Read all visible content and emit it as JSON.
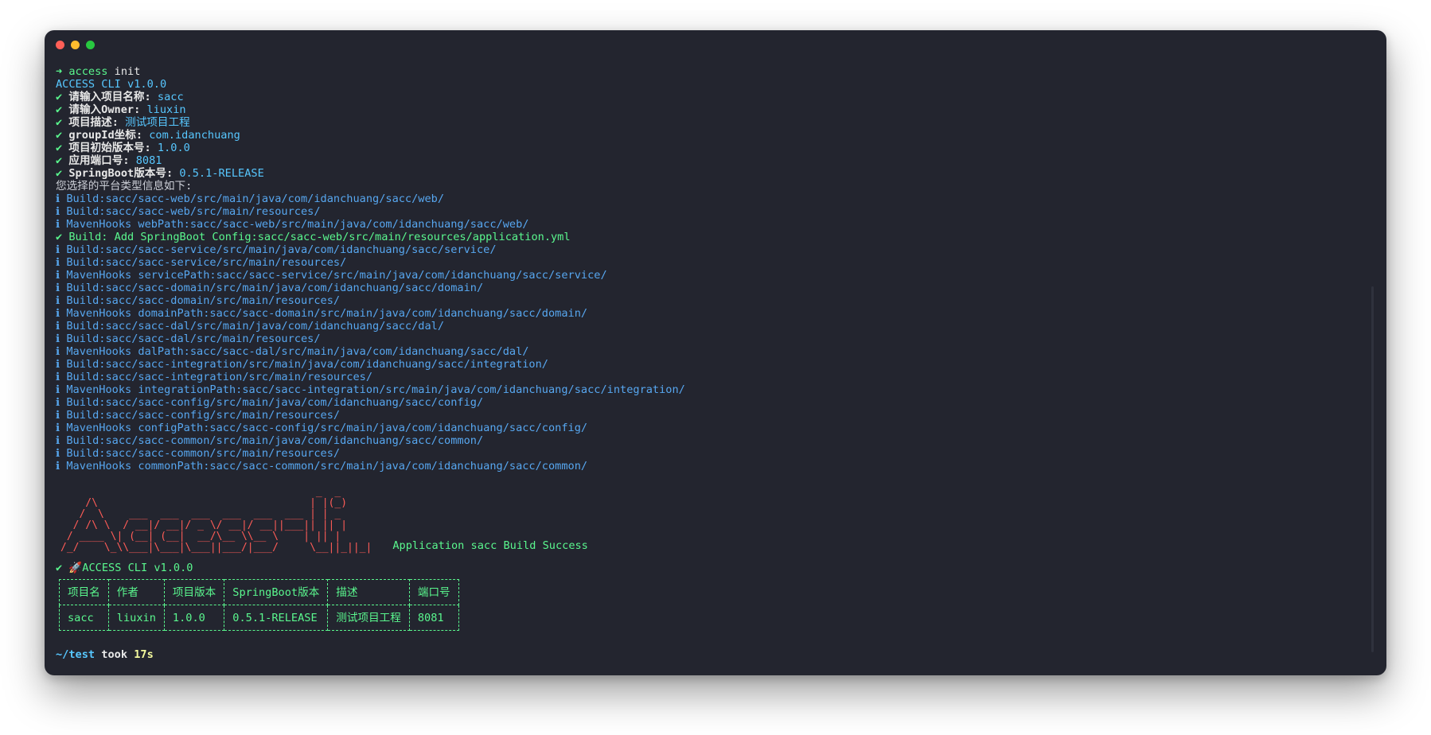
{
  "window": {
    "traffic_lights": [
      "close",
      "minimize",
      "zoom"
    ]
  },
  "terminal": {
    "prompt_arrow": "➜",
    "command": "access",
    "command_arg": " init",
    "version_line": "ACCESS CLI v1.0.0",
    "answers": [
      {
        "mark": "✔",
        "label": "请输入项目名称:",
        "value": "sacc"
      },
      {
        "mark": "✔",
        "label": "请输入Owner:",
        "value": "liuxin"
      },
      {
        "mark": "✔",
        "label": "项目描述:",
        "value": "测试项目工程"
      },
      {
        "mark": "✔",
        "label": "groupId坐标:",
        "value": "com.idanchuang"
      },
      {
        "mark": "✔",
        "label": "项目初始版本号:",
        "value": "1.0.0"
      },
      {
        "mark": "✔",
        "label": "应用端口号:",
        "value": "8081"
      },
      {
        "mark": "✔",
        "label": "SpringBoot版本号:",
        "value": "0.5.1-RELEASE"
      }
    ],
    "platform_line": "您选择的平台类型信息如下:",
    "build_logs": [
      {
        "mark": "ℹ",
        "kind": "info",
        "text": "Build:sacc/sacc-web/src/main/java/com/idanchuang/sacc/web/"
      },
      {
        "mark": "ℹ",
        "kind": "info",
        "text": "Build:sacc/sacc-web/src/main/resources/"
      },
      {
        "mark": "ℹ",
        "kind": "info",
        "text": "MavenHooks webPath:sacc/sacc-web/src/main/java/com/idanchuang/sacc/web/"
      },
      {
        "mark": "✔",
        "kind": "success",
        "text": "Build: Add SpringBoot Config:sacc/sacc-web/src/main/resources/application.yml"
      },
      {
        "mark": "ℹ",
        "kind": "info",
        "text": "Build:sacc/sacc-service/src/main/java/com/idanchuang/sacc/service/"
      },
      {
        "mark": "ℹ",
        "kind": "info",
        "text": "Build:sacc/sacc-service/src/main/resources/"
      },
      {
        "mark": "ℹ",
        "kind": "info",
        "text": "MavenHooks servicePath:sacc/sacc-service/src/main/java/com/idanchuang/sacc/service/"
      },
      {
        "mark": "ℹ",
        "kind": "info",
        "text": "Build:sacc/sacc-domain/src/main/java/com/idanchuang/sacc/domain/"
      },
      {
        "mark": "ℹ",
        "kind": "info",
        "text": "Build:sacc/sacc-domain/src/main/resources/"
      },
      {
        "mark": "ℹ",
        "kind": "info",
        "text": "MavenHooks domainPath:sacc/sacc-domain/src/main/java/com/idanchuang/sacc/domain/"
      },
      {
        "mark": "ℹ",
        "kind": "info",
        "text": "Build:sacc/sacc-dal/src/main/java/com/idanchuang/sacc/dal/"
      },
      {
        "mark": "ℹ",
        "kind": "info",
        "text": "Build:sacc/sacc-dal/src/main/resources/"
      },
      {
        "mark": "ℹ",
        "kind": "info",
        "text": "MavenHooks dalPath:sacc/sacc-dal/src/main/java/com/idanchuang/sacc/dal/"
      },
      {
        "mark": "ℹ",
        "kind": "info",
        "text": "Build:sacc/sacc-integration/src/main/java/com/idanchuang/sacc/integration/"
      },
      {
        "mark": "ℹ",
        "kind": "info",
        "text": "Build:sacc/sacc-integration/src/main/resources/"
      },
      {
        "mark": "ℹ",
        "kind": "info",
        "text": "MavenHooks integrationPath:sacc/sacc-integration/src/main/java/com/idanchuang/sacc/integration/"
      },
      {
        "mark": "ℹ",
        "kind": "info",
        "text": "Build:sacc/sacc-config/src/main/java/com/idanchuang/sacc/config/"
      },
      {
        "mark": "ℹ",
        "kind": "info",
        "text": "Build:sacc/sacc-config/src/main/resources/"
      },
      {
        "mark": "ℹ",
        "kind": "info",
        "text": "MavenHooks configPath:sacc/sacc-config/src/main/java/com/idanchuang/sacc/config/"
      },
      {
        "mark": "ℹ",
        "kind": "info",
        "text": "Build:sacc/sacc-common/src/main/java/com/idanchuang/sacc/common/"
      },
      {
        "mark": "ℹ",
        "kind": "info",
        "text": "Build:sacc/sacc-common/src/main/resources/"
      },
      {
        "mark": "ℹ",
        "kind": "info",
        "text": "MavenHooks commonPath:sacc/sacc-common/src/main/java/com/idanchuang/sacc/common/"
      }
    ],
    "banner_ascii": "                                         _  _ \n    /\\                                  | |(_)\n   /  \\    ___  ___  ___  ___  ___  ___ | | _ \n  / /\\ \\  / __|/ __|/ _ \\/ __|/ __||___|| || |\n / ____ \\| (__| (__|  __/\\__ \\\\__ \\    | || |\n/_/    \\_\\\\___|\\___|\\___||___/|___/     \\__||_||_|",
    "banner_message": "Application sacc Build Success",
    "final_mark": "✔",
    "final_line": "🚀ACCESS CLI v1.0.0",
    "summary_table": {
      "headers": [
        "项目名",
        "作者",
        "项目版本",
        "SpringBoot版本",
        "描述",
        "端口号"
      ],
      "rows": [
        [
          "sacc",
          "liuxin",
          "1.0.0",
          "0.5.1-RELEASE",
          "测试项目工程",
          "8081"
        ]
      ]
    },
    "end_prompt": {
      "path": "~/test",
      "took": " took ",
      "duration": "17s"
    }
  },
  "colors": {
    "background": "#23252f",
    "green": "#5af78e",
    "info_blue": "#57a7f0",
    "cyan": "#57c7ff",
    "red": "#ff5c57",
    "yellow": "#f3f99d"
  }
}
